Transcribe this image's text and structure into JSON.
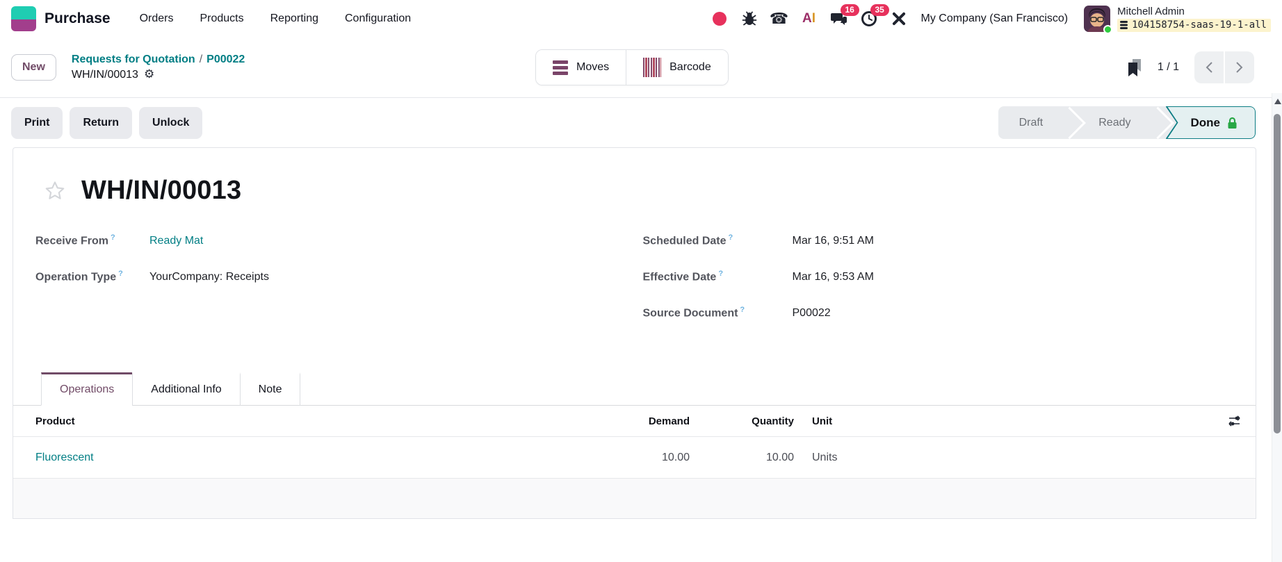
{
  "nav": {
    "app_name": "Purchase",
    "menu": [
      "Orders",
      "Products",
      "Reporting",
      "Configuration"
    ],
    "systray": {
      "message_badge": "16",
      "activity_badge": "35",
      "company": "My Company (San Francisco)",
      "user_name": "Mitchell Admin",
      "database": "104158754-saas-19-1-all",
      "ai_a": "A",
      "ai_i": "I",
      "phone_glyph": "☎"
    }
  },
  "breadcrumb": {
    "new_button": "New",
    "link1": "Requests for Quotation",
    "sep": "/",
    "link2": "P00022",
    "current": "WH/IN/00013",
    "gear_glyph": "⚙"
  },
  "view_buttons": {
    "moves": "Moves",
    "barcode": "Barcode"
  },
  "pager": {
    "value": "1 / 1"
  },
  "control_panel": {
    "buttons": [
      "Print",
      "Return",
      "Unlock"
    ],
    "stages": {
      "draft": "Draft",
      "ready": "Ready",
      "done": "Done"
    }
  },
  "form": {
    "title": "WH/IN/00013",
    "help_marker": "?",
    "fields_left": [
      {
        "label": "Receive From",
        "value": "Ready Mat"
      },
      {
        "label": "Operation Type",
        "value": "YourCompany: Receipts"
      }
    ],
    "fields_right": [
      {
        "label": "Scheduled Date",
        "value": "Mar 16, 9:51 AM"
      },
      {
        "label": "Effective Date",
        "value": "Mar 16, 9:53 AM"
      },
      {
        "label": "Source Document",
        "value": "P00022"
      }
    ],
    "tabs": [
      "Operations",
      "Additional Info",
      "Note"
    ],
    "table": {
      "columns": [
        "Product",
        "Demand",
        "Quantity",
        "Unit"
      ],
      "rows": [
        {
          "product": "Fluorescent",
          "demand": "10.00",
          "quantity": "10.00",
          "unit": "Units"
        }
      ]
    }
  },
  "colors": {
    "brand_purple": "#714b67",
    "teal_link": "#017e84",
    "badge_red": "#e7315c",
    "done_bg": "#e4f0f1",
    "done_border": "#0c7d84",
    "lock_green": "#28a745",
    "db_highlight": "#fcf3cd",
    "logo_teal": "#1fcdb2",
    "logo_magenta": "#a23e8c"
  }
}
